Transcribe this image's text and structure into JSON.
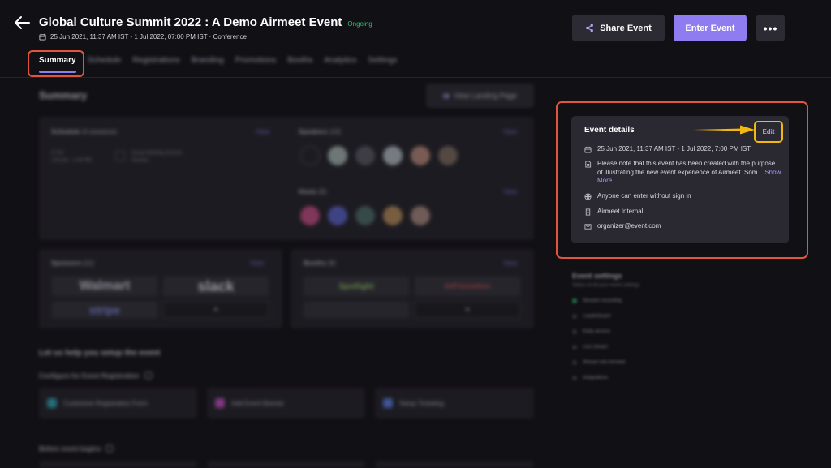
{
  "header": {
    "title": "Global Culture Summit 2022 : A Demo Airmeet Event",
    "status": "Ongoing",
    "subtitle": "25 Jun 2021, 11:37 AM IST - 1 Jul 2022, 07:00 PM IST · Conference",
    "share_label": "Share Event",
    "enter_label": "Enter Event",
    "more_label": "•••"
  },
  "tabs": [
    "Summary",
    "Schedule",
    "Registrations",
    "Branding",
    "Promotions",
    "Booths",
    "Analytics",
    "Settings"
  ],
  "summary": {
    "title": "Summary",
    "landing_button": "View Landing Page",
    "schedule_label": "Schedule",
    "schedule_count": "(4 sessions)",
    "schedule_time": "07:00",
    "schedule_time_sub": "1:00 pm - 1:30 PM",
    "schedule_session": "Group Meeting Session",
    "schedule_session_sub": "Session",
    "speakers_label": "Speakers",
    "speakers_count": "(10)",
    "hosts_label": "Hosts",
    "hosts_count": "(6)",
    "sponsors_label": "Sponsors",
    "sponsors_count": "(11)",
    "booths_label": "Booths",
    "booths_count": "(8)",
    "view_label": "View",
    "sponsor_logos": [
      "Walmart",
      "slack",
      "stripe"
    ],
    "booth_logos": [
      "Spotlight",
      "Staff Innovations"
    ],
    "setup_title": "Let us help you setup the event",
    "configure_label": "Configure for Event Registration",
    "cards": [
      "Customize Registration Form",
      "Add Event Banner",
      "Setup Ticketing"
    ],
    "before_label": "Before event begins"
  },
  "event_details": {
    "title": "Event details",
    "edit_label": "Edit",
    "date": "25 Jun 2021, 11:37 AM IST - 1 Jul 2022, 7:00 PM IST",
    "description": "Please note that this event has been created with the purpose of illustrating the new event experience of Airmeet. Som...",
    "show_more": "Show More",
    "access": "Anyone can enter without sign in",
    "organization": "Airmeet Internal",
    "email": "organizer@event.com"
  },
  "event_settings": {
    "title": "Event settings",
    "subtitle": "Status of all your event settings",
    "items": [
      "Session recording",
      "Leaderboard",
      "Early access",
      "Live stream",
      "Stream into Airmeet",
      "Integrations"
    ]
  },
  "colors": {
    "accent": "#8e7cf0",
    "highlight": "#e0553d",
    "edit_callout": "#f2b90f",
    "ongoing": "#2fbe6d"
  }
}
